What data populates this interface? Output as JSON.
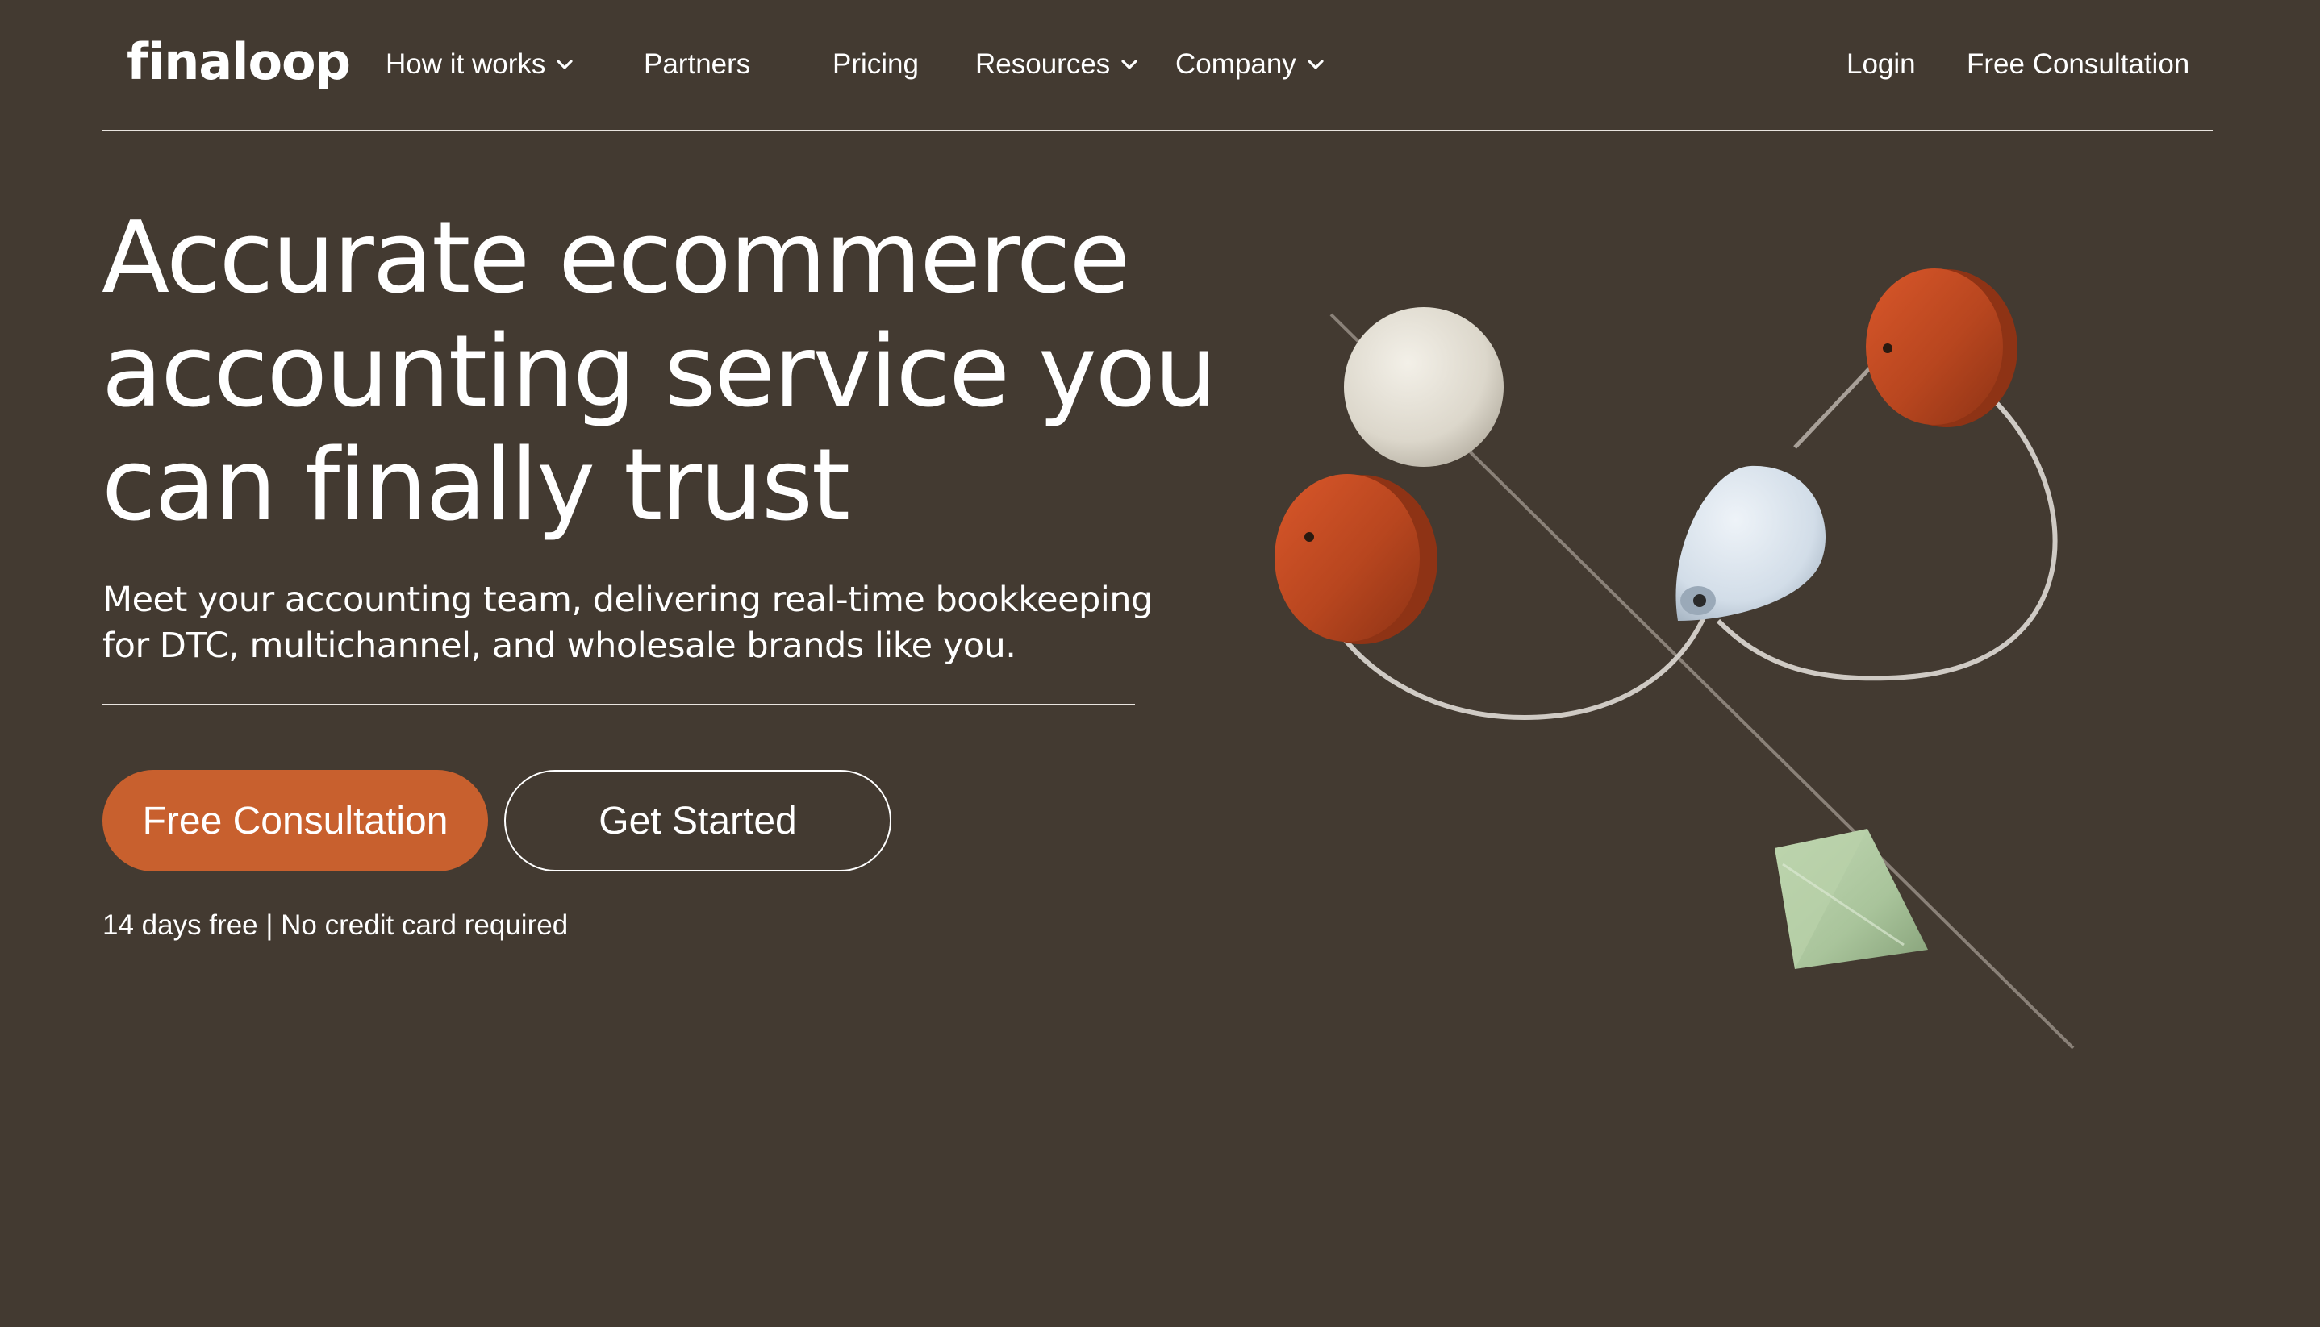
{
  "brand": {
    "logo_text": "finaloop"
  },
  "nav": {
    "items": [
      {
        "label": "How it works",
        "has_dropdown": true
      },
      {
        "label": "Partners",
        "has_dropdown": false
      },
      {
        "label": "Pricing",
        "has_dropdown": false
      },
      {
        "label": "Resources",
        "has_dropdown": true
      },
      {
        "label": "Company",
        "has_dropdown": true
      }
    ],
    "login_label": "Login",
    "consultation_label": "Free Consultation"
  },
  "hero": {
    "title_lines": [
      "Accurate ecommerce",
      "accounting service you",
      "can finally trust"
    ],
    "subtitle_lines": [
      "Meet your accounting team, delivering real-time bookkeeping",
      "for DTC, multichannel, and wholesale brands like you."
    ],
    "primary_button": "Free Consultation",
    "secondary_button": "Get Started",
    "note": "14 days free | No credit card required"
  },
  "colors": {
    "background": "#433a31",
    "accent": "#c8602e",
    "text": "#ffffff",
    "divider": "#e9e4df",
    "bead_red": "#b8461f",
    "bead_white": "#e6e2d8",
    "bead_blue": "#d7e2ec",
    "bead_green": "#a9c49b"
  }
}
